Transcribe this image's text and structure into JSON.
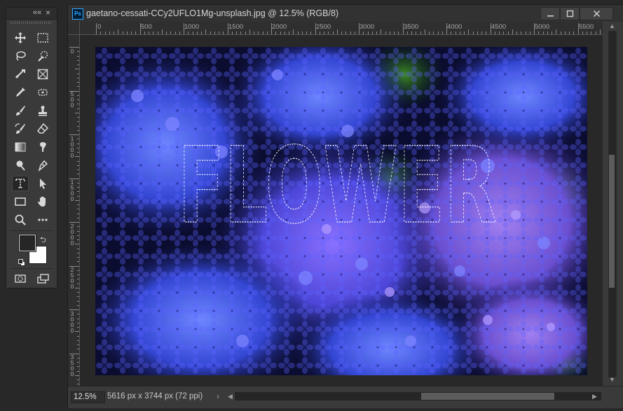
{
  "tools_panel": {
    "collapse_label": "««",
    "close_label": "×",
    "tools": [
      {
        "icon": "move-icon"
      },
      {
        "icon": "rectangular-marquee-icon"
      },
      {
        "icon": "lasso-icon"
      },
      {
        "icon": "quick-selection-icon"
      },
      {
        "icon": "crop-icon"
      },
      {
        "icon": "frame-icon"
      },
      {
        "icon": "eyedropper-icon"
      },
      {
        "icon": "spot-healing-icon"
      },
      {
        "icon": "brush-icon"
      },
      {
        "icon": "clone-stamp-icon"
      },
      {
        "icon": "history-brush-icon"
      },
      {
        "icon": "eraser-icon"
      },
      {
        "icon": "gradient-icon"
      },
      {
        "icon": "smudge-icon"
      },
      {
        "icon": "dodge-icon"
      },
      {
        "icon": "pen-icon"
      },
      {
        "icon": "type-mask-icon"
      },
      {
        "icon": "path-selection-icon"
      },
      {
        "icon": "rectangle-shape-icon"
      },
      {
        "icon": "hand-icon"
      },
      {
        "icon": "zoom-icon"
      },
      {
        "icon": "more-tools-icon"
      }
    ],
    "active_tool": "type-mask-icon",
    "foreground_color": "#262626",
    "background_color": "#ffffff"
  },
  "document": {
    "app_badge": "Ps",
    "title": "gaetano-cessati-CCy2UFLO1Mg-unsplash.jpg @ 12.5% (RGB/8)",
    "horizontal_ruler_labels": [
      "0",
      "500",
      "1000",
      "1500",
      "2000",
      "2500",
      "3000",
      "3500",
      "4000",
      "4500",
      "5000",
      "5500"
    ],
    "vertical_ruler_labels": [
      "0",
      "500",
      "1000",
      "1500",
      "2000",
      "2500",
      "3000",
      "3500"
    ],
    "selection_text": "FLOWER",
    "colors": {
      "petal_blue": "#4a4fe0",
      "petal_violet": "#7b55d8",
      "leaf_green": "#2f7a1e",
      "shadow": "#0a0d33"
    }
  },
  "status_bar": {
    "zoom": "12.5%",
    "doc_info": "5616 px x 3744 px (72 ppi)",
    "menu_arrow": "›"
  }
}
